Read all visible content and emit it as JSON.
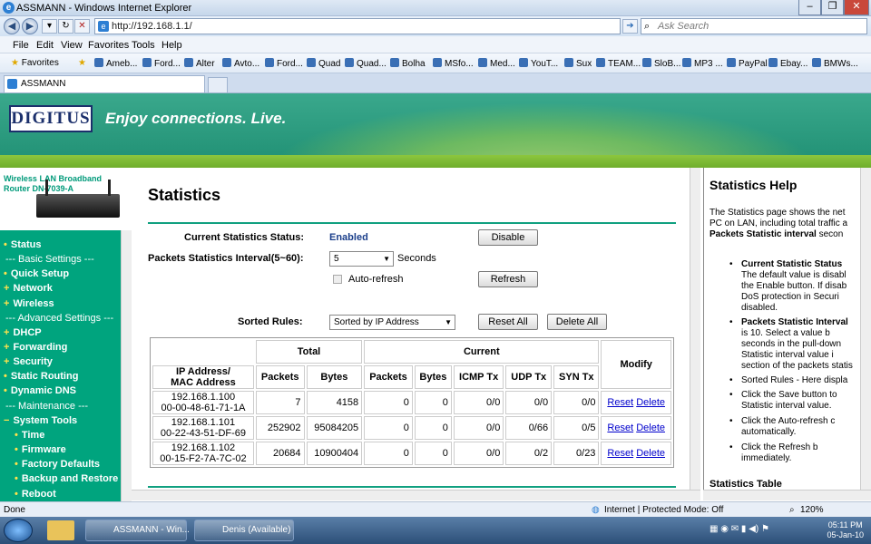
{
  "window": {
    "title": "ASSMANN - Windows Internet Explorer"
  },
  "address": {
    "url": "http://192.168.1.1/",
    "search_placeholder": "Ask Search"
  },
  "menu": [
    "File",
    "Edit",
    "View",
    "Favorites",
    "Tools",
    "Help"
  ],
  "favorites": {
    "label": "Favorites",
    "items": [
      "Ameb...",
      "Ford...",
      "Alter",
      "Avto...",
      "Ford...",
      "Quad",
      "Quad...",
      "Bolha",
      "MSfo...",
      "Med...",
      "YouT...",
      "Sux",
      "TEAM...",
      "SloB...",
      "MP3 ...",
      "PayPal",
      "Ebay...",
      "BMWs..."
    ]
  },
  "tab": {
    "label": "ASSMANN"
  },
  "banner": {
    "logo": "DIGITUS",
    "slogan": "Enjoy connections. Live."
  },
  "product": {
    "name": "Wireless LAN Broadband Router DN-7039-A"
  },
  "nav": {
    "items": [
      {
        "label": "Status",
        "type": "item"
      },
      {
        "label": "--- Basic Settings ---",
        "type": "sec"
      },
      {
        "label": "Quick Setup",
        "type": "item"
      },
      {
        "label": "Network",
        "type": "item"
      },
      {
        "label": "Wireless",
        "type": "item"
      },
      {
        "label": "--- Advanced Settings ---",
        "type": "sec"
      },
      {
        "label": "DHCP",
        "type": "item"
      },
      {
        "label": "Forwarding",
        "type": "item"
      },
      {
        "label": "Security",
        "type": "item"
      },
      {
        "label": "Static Routing",
        "type": "item"
      },
      {
        "label": "Dynamic DNS",
        "type": "item"
      },
      {
        "label": "--- Maintenance ---",
        "type": "sec"
      },
      {
        "label": "System Tools",
        "type": "item"
      },
      {
        "label": "Time",
        "type": "sub"
      },
      {
        "label": "Firmware",
        "type": "sub"
      },
      {
        "label": "Factory Defaults",
        "type": "sub"
      },
      {
        "label": "Backup and Restore",
        "type": "sub"
      },
      {
        "label": "Reboot",
        "type": "sub"
      }
    ]
  },
  "page": {
    "title": "Statistics",
    "status_label": "Current Statistics Status:",
    "status_value": "Enabled",
    "disable_btn": "Disable",
    "interval_label": "Packets Statistics Interval(5~60):",
    "interval_value": "5",
    "interval_unit": "Seconds",
    "autorefresh_label": "Auto-refresh",
    "refresh_btn": "Refresh",
    "sorted_label": "Sorted Rules:",
    "sorted_value": "Sorted by IP Address",
    "reset_all_btn": "Reset All",
    "delete_all_btn": "Delete All",
    "table": {
      "hdr_ip": "IP Address/",
      "hdr_mac": "MAC Address",
      "hdr_total": "Total",
      "hdr_current": "Current",
      "hdr_modify": "Modify",
      "sub_headers": [
        "Packets",
        "Bytes",
        "Packets",
        "Bytes",
        "ICMP Tx",
        "UDP Tx",
        "SYN Tx"
      ],
      "reset": "Reset",
      "delete": "Delete",
      "rows": [
        {
          "ip": "192.168.1.100",
          "mac": "00-00-48-61-71-1A",
          "t_packets": "7",
          "t_bytes": "4158",
          "c_packets": "0",
          "c_bytes": "0",
          "icmp": "0/0",
          "udp": "0/0",
          "syn": "0/0"
        },
        {
          "ip": "192.168.1.101",
          "mac": "00-22-43-51-DF-69",
          "t_packets": "252902",
          "t_bytes": "95084205",
          "c_packets": "0",
          "c_bytes": "0",
          "icmp": "0/0",
          "udp": "0/66",
          "syn": "0/5"
        },
        {
          "ip": "192.168.1.102",
          "mac": "00-15-F2-7A-7C-02",
          "t_packets": "20684",
          "t_bytes": "10900404",
          "c_packets": "0",
          "c_bytes": "0",
          "icmp": "0/0",
          "udp": "0/2",
          "syn": "0/23"
        }
      ]
    }
  },
  "help": {
    "title": "Statistics Help",
    "intro": [
      "The Statistics page shows the net",
      "PC on LAN, including total traffic a"
    ],
    "intro_bold": "Packets Statistic interval",
    "intro_tail": " secon",
    "bullets": [
      {
        "lines": [
          "Current Statistic Status",
          "The default value is disabl",
          "the Enable button. If disab",
          "DoS protection in Securi",
          "disabled."
        ]
      },
      {
        "lines": [
          "Packets Statistic Interval",
          "is 10. Select a value b",
          "seconds in the pull-down",
          "Statistic interval value i",
          "section of the packets statis"
        ]
      },
      {
        "lines": [
          "Sorted Rules - Here displa"
        ]
      },
      {
        "lines": [
          "Click the Save button to",
          "Statistic interval value."
        ]
      },
      {
        "lines": [
          "Click the Auto-refresh c",
          "automatically."
        ]
      },
      {
        "lines": [
          "Click the Refresh b",
          "immediately."
        ]
      }
    ],
    "footer": "Statistics Table"
  },
  "statusbar": {
    "left": "Done",
    "zone": "Internet | Protected Mode: Off",
    "zoom": "120%"
  },
  "taskbar": {
    "items": [
      "ASSMANN - Win...",
      "Denis (Available)"
    ],
    "time": "05:11 PM",
    "date": "05-Jan-10"
  },
  "colors": {
    "accent": "#00a47e",
    "link": "#0000cc",
    "status_enabled": "#1a3e8a"
  }
}
